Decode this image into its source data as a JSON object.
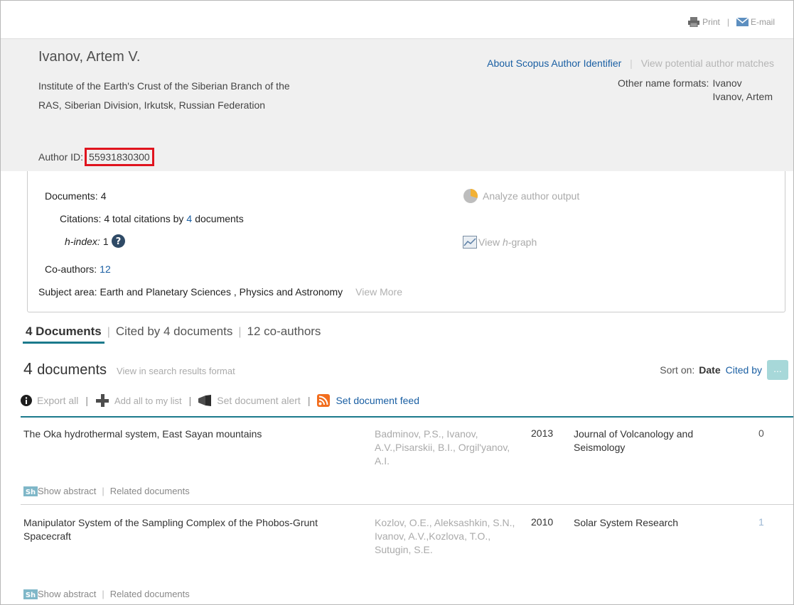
{
  "topbar": {
    "print": "Print",
    "email": "E-mail"
  },
  "author": {
    "name": "Ivanov, Artem V.",
    "affiliation": "Institute of the Earth's Crust of the Siberian Branch of the RAS, Siberian Division, Irkutsk, Russian Federation",
    "author_id_label": "Author ID:",
    "author_id": "55931830300",
    "about_link": "About Scopus Author Identifier",
    "matches_link": "View potential author matches",
    "other_names_label": "Other name formats:",
    "other_names": [
      "Ivanov",
      "Ivanov, Artem"
    ]
  },
  "metrics": {
    "documents_label": "Documents:",
    "documents_value": "4",
    "citations_label": "Citations:",
    "citations_prefix": "4 total citations by",
    "citations_docs": "4",
    "citations_suffix": "documents",
    "hindex_label": "h-index:",
    "hindex_value": "1",
    "coauthors_label": "Co-authors:",
    "coauthors_value": "12",
    "subject_label": "Subject area:",
    "subject_value": "Earth and Planetary Sciences ,  Physics and Astronomy",
    "view_more": "View More",
    "analyze": "Analyze author output",
    "hgraph_prefix": "View",
    "hgraph_h": "h",
    "hgraph_suffix": "-graph"
  },
  "tabs": [
    {
      "label": "4 Documents"
    },
    {
      "label": "Cited by 4 documents"
    },
    {
      "label": "12 co-authors"
    }
  ],
  "docs": {
    "count": "4",
    "count_label": "documents",
    "view_search": "View in search results format",
    "sort_label": "Sort on:",
    "sort_date": "Date",
    "sort_cited": "Cited by",
    "more": "..."
  },
  "toolbar": {
    "export": "Export all",
    "add": "Add all to my list",
    "alert": "Set document alert",
    "feed": "Set document feed"
  },
  "results": [
    {
      "title": "The Oka hydrothermal system, East Sayan mountains",
      "authors": "Badminov, P.S., Ivanov, A.V.,Pisarskii, B.I., Orgil'yanov, A.I.",
      "year": "2013",
      "source": "Journal of Volcanology and Seismology",
      "cited": "0",
      "show_abstract": "Show abstract",
      "related": "Related documents"
    },
    {
      "title": "Manipulator System of the Sampling Complex of the Phobos-Grunt Spacecraft",
      "authors": "Kozlov, O.E., Aleksashkin, S.N., Ivanov, A.V.,Kozlova, T.O., Sutugin, S.E.",
      "year": "2010",
      "source": "Solar System Research",
      "cited": "1",
      "show_abstract": "Show abstract",
      "related": "Related documents"
    }
  ]
}
